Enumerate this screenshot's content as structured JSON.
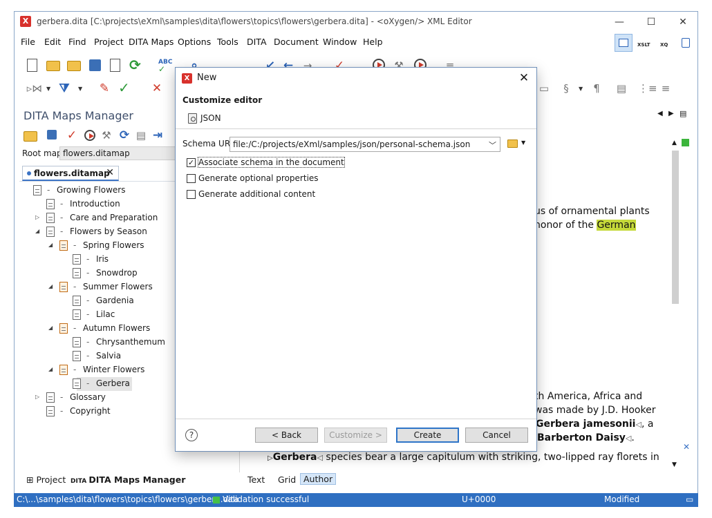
{
  "window": {
    "title": "gerbera.dita [C:\\projects\\eXml\\samples\\dita\\flowers\\topics\\flowers\\gerbera.dita] - <oXygen/> XML Editor",
    "logo": "X"
  },
  "menu": [
    "File",
    "Edit",
    "Find",
    "Project",
    "DITA Maps",
    "Options",
    "Tools",
    "DITA",
    "Document",
    "Window",
    "Help"
  ],
  "perspectives": {
    "xslt": "XSLT",
    "xquery": "XQ"
  },
  "left_panel": {
    "title": "DITA Maps Manager",
    "root_map_label": "Root map:",
    "root_map_value": "flowers.ditamap",
    "tab_label": "flowers.ditamap",
    "tab_close": "✕",
    "tree": [
      {
        "label": "Growing Flowers",
        "level": 0,
        "twisty": "",
        "head": false
      },
      {
        "label": "Introduction",
        "level": 1,
        "twisty": "",
        "head": false
      },
      {
        "label": "Care and Preparation",
        "level": 1,
        "twisty": "▷",
        "head": false
      },
      {
        "label": "Flowers by Season",
        "level": 1,
        "twisty": "◢",
        "head": false
      },
      {
        "label": "Spring Flowers",
        "level": 2,
        "twisty": "◢",
        "head": true
      },
      {
        "label": "Iris",
        "level": 3,
        "twisty": "",
        "head": false
      },
      {
        "label": "Snowdrop",
        "level": 3,
        "twisty": "",
        "head": false
      },
      {
        "label": "Summer Flowers",
        "level": 2,
        "twisty": "◢",
        "head": true
      },
      {
        "label": "Gardenia",
        "level": 3,
        "twisty": "",
        "head": false
      },
      {
        "label": "Lilac",
        "level": 3,
        "twisty": "",
        "head": false
      },
      {
        "label": "Autumn Flowers",
        "level": 2,
        "twisty": "◢",
        "head": true
      },
      {
        "label": "Chrysanthemum",
        "level": 3,
        "twisty": "",
        "head": false
      },
      {
        "label": "Salvia",
        "level": 3,
        "twisty": "",
        "head": false
      },
      {
        "label": "Winter Flowers",
        "level": 2,
        "twisty": "◢",
        "head": true
      },
      {
        "label": "Gerbera",
        "level": 3,
        "twisty": "",
        "head": false,
        "selected": true
      },
      {
        "label": "Glossary",
        "level": 1,
        "twisty": "▷",
        "head": false
      },
      {
        "label": "Copyright",
        "level": 1,
        "twisty": "",
        "head": false
      }
    ],
    "bottom_tabs": [
      "Project",
      "DITA Maps Manager"
    ]
  },
  "editor": {
    "line1": "us of ornamental plants",
    "line2_pre": "honor of the ",
    "line2_hl": "German",
    "line3": "th America, Africa and",
    "line4": "was made by J.D. Hooker",
    "line5_bold": "Gerbera jamesonii",
    "line5_post": ", a",
    "line6_bold": "Barberton Daisy",
    "line6_post": ".",
    "line7_bold": "Gerbera",
    "line7_post": " species bear a large capitulum with striking, two-lipped ray florets in",
    "tabs": [
      "Text",
      "Grid",
      "Author"
    ],
    "active_tab": "Author"
  },
  "statusbar": {
    "path": "C:\\...\\samples\\dita\\flowers\\topics\\flowers\\gerbera.dita",
    "validation": "Validation successful",
    "unicode": "U+0000",
    "modified": "Modified"
  },
  "dialog": {
    "title": "New",
    "heading": "Customize editor",
    "type_label": "JSON",
    "schema_label": "Schema URL:",
    "schema_value": "file:/C:/projects/eXml/samples/json/personal-schema.json",
    "options": [
      {
        "label": "Associate schema in the document",
        "checked": true
      },
      {
        "label": "Generate optional properties",
        "checked": false
      },
      {
        "label": "Generate additional content",
        "checked": false
      }
    ],
    "buttons": {
      "back": "< Back",
      "customize": "Customize >",
      "create": "Create",
      "cancel": "Cancel"
    },
    "help": "?"
  }
}
